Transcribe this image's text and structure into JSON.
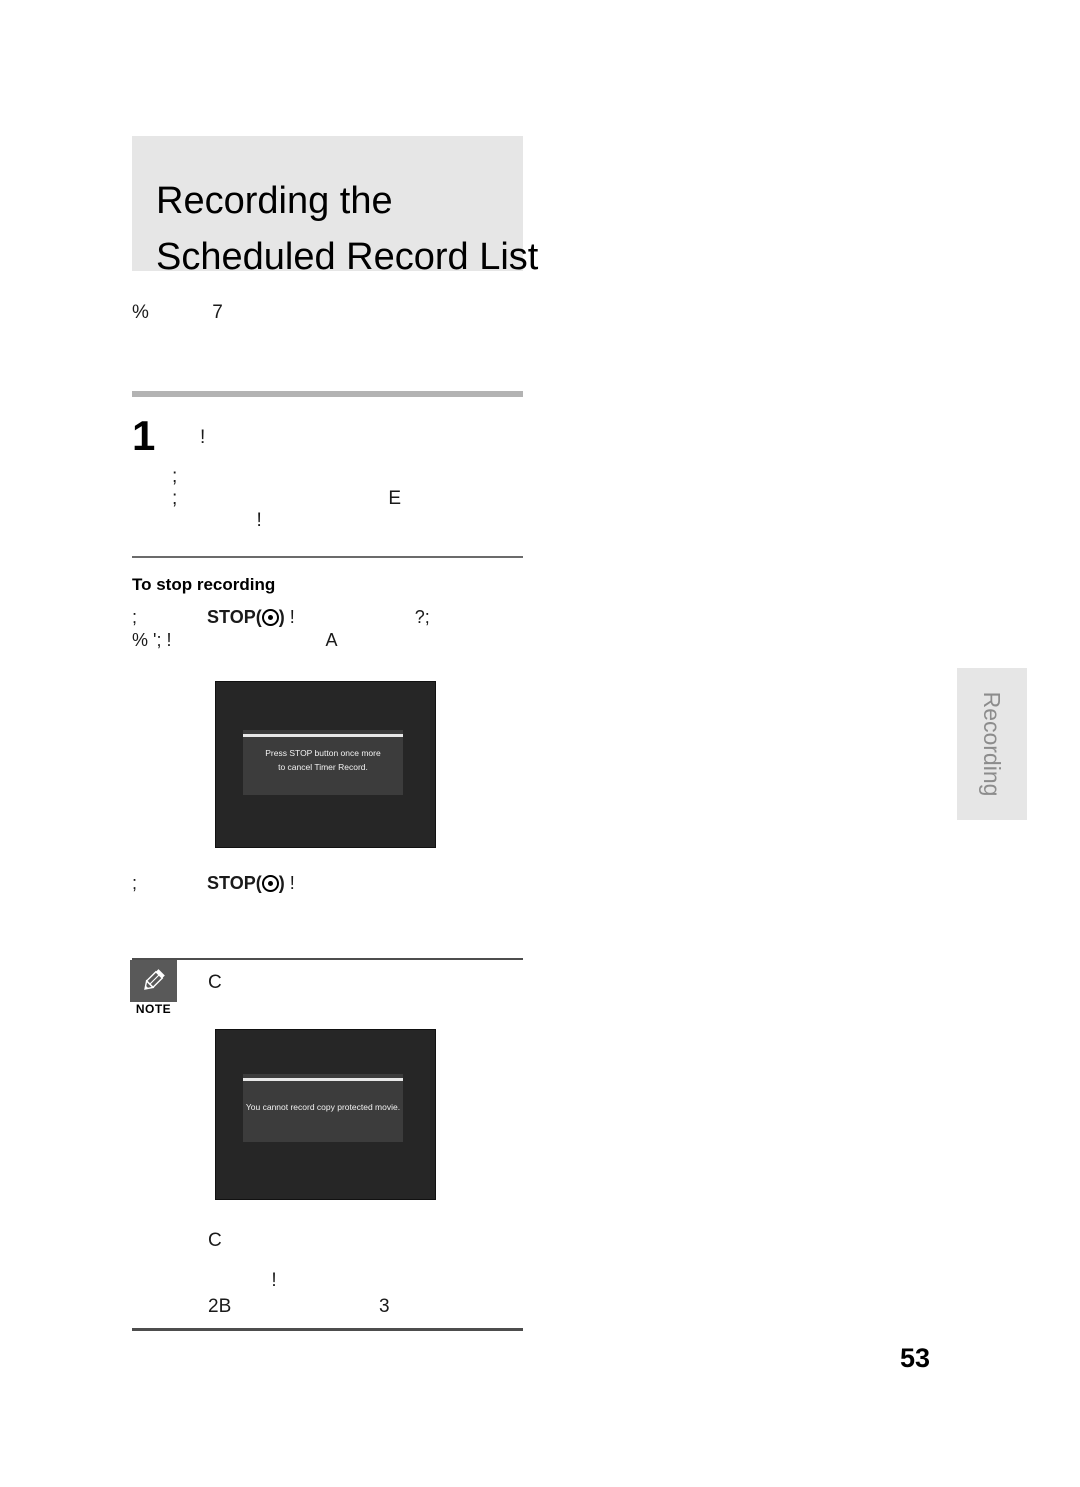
{
  "page": {
    "number": "53",
    "side_tab": "Recording"
  },
  "header": {
    "title_line_1": "Recording the",
    "title_line_2": "Scheduled Record List",
    "band_color": "#e6e6e6"
  },
  "intro": {
    "text": "%            7"
  },
  "step_1": {
    "number": "1",
    "text": "!",
    "sub_line_1": ";",
    "sub_line_2": ";                                        E",
    "sub_line_3": "                !"
  },
  "stop_recording": {
    "heading": "To stop recording",
    "line_1_prefix": ";              ",
    "line_1_button": "STOP",
    "line_1_paren_open": "(",
    "line_1_paren_close": ")",
    "line_1_suffix": " !                        ?;",
    "line_2": "% '; !                               A",
    "line_3_prefix": ";              ",
    "line_3_button": "STOP",
    "line_3_paren_open": "(",
    "line_3_paren_close": ")",
    "line_3_suffix": " !",
    "button_icon": "record-circle-icon"
  },
  "tv_screenshot_1": {
    "name": "timer-record-cancel-osd",
    "message_line_1": "Press STOP button once more",
    "message_line_2": "to cancel Timer Record.",
    "screen_color": "#262626",
    "dialog_color": "#3c3c3c",
    "topbar_color": "#e8e8e8"
  },
  "tv_screenshot_2": {
    "name": "copy-protected-osd",
    "message_line_1": "You cannot record copy protected movie.",
    "screen_color": "#262626",
    "dialog_color": "#3c3c3c",
    "topbar_color": "#e8e8e8"
  },
  "note": {
    "label": "NOTE",
    "icon": "pencil-icon",
    "badge_color": "#595959",
    "text": "C"
  },
  "bottom": {
    "line_1": "C",
    "line_2": "            !",
    "line_3": "2B                            3"
  }
}
